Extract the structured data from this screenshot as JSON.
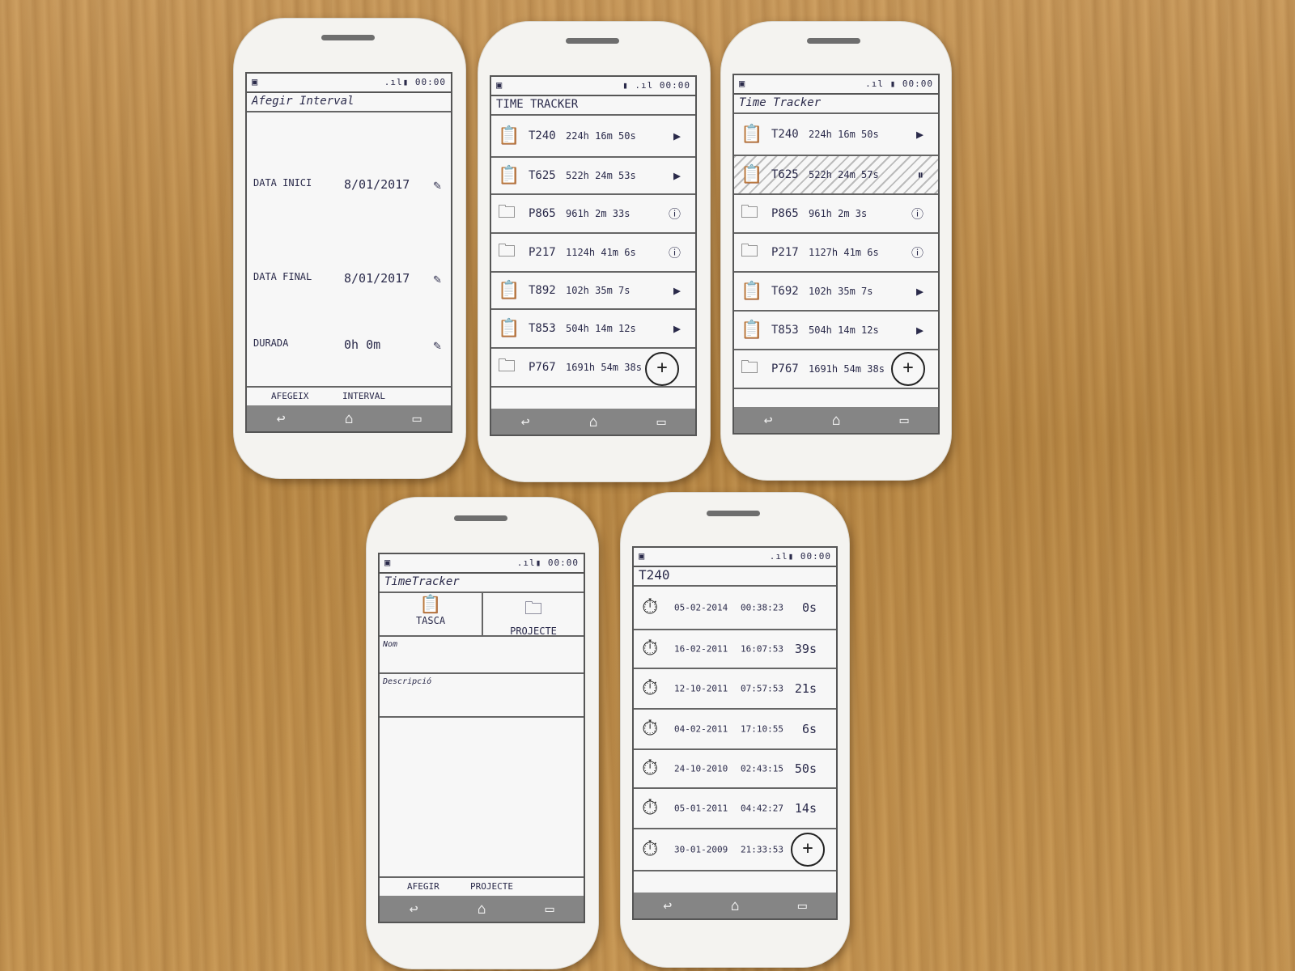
{
  "status": {
    "clock": "00:00",
    "signal": ".ıl"
  },
  "screen1": {
    "title": "Afegir Interval",
    "fields": [
      {
        "label": "DATA INICI",
        "value": "8/01/2017"
      },
      {
        "label": "DATA FINAL",
        "value": "8/01/2017"
      },
      {
        "label": "DURADA",
        "value": "0h 0m"
      }
    ],
    "actions": [
      "AFEGEIX",
      "INTERVAL"
    ]
  },
  "screen2": {
    "title": "TIME TRACKER",
    "items": [
      {
        "kind": "task",
        "name": "T240",
        "time": "224h 16m 50s",
        "status": "play"
      },
      {
        "kind": "task",
        "name": "T625",
        "time": "522h 24m 53s",
        "status": "play"
      },
      {
        "kind": "project",
        "name": "P865",
        "time": "961h 2m 33s",
        "status": "info"
      },
      {
        "kind": "project",
        "name": "P217",
        "time": "1124h 41m 6s",
        "status": "info"
      },
      {
        "kind": "task",
        "name": "T892",
        "time": "102h 35m 7s",
        "status": "play"
      },
      {
        "kind": "task",
        "name": "T853",
        "time": "504h 14m 12s",
        "status": "play"
      },
      {
        "kind": "project",
        "name": "P767",
        "time": "1691h 54m 38s",
        "status": ""
      }
    ]
  },
  "screen3": {
    "title": "Time Tracker",
    "items": [
      {
        "kind": "task",
        "name": "T240",
        "time": "224h 16m 50s",
        "status": "play"
      },
      {
        "kind": "task",
        "name": "T625",
        "time": "522h 24m 57s",
        "status": "pause"
      },
      {
        "kind": "project",
        "name": "P865",
        "time": "961h 2m 3s",
        "status": "info"
      },
      {
        "kind": "project",
        "name": "P217",
        "time": "1127h 41m 6s",
        "status": "info"
      },
      {
        "kind": "task",
        "name": "T692",
        "time": "102h 35m 7s",
        "status": "play"
      },
      {
        "kind": "task",
        "name": "T853",
        "time": "504h 14m 12s",
        "status": "play"
      },
      {
        "kind": "project",
        "name": "P767",
        "time": "1691h 54m 38s",
        "status": ""
      }
    ]
  },
  "screen4": {
    "title": "TimeTracker",
    "tabs": [
      "TASCA",
      "PROJECTE"
    ],
    "fields": [
      "Nom",
      "Descripció"
    ],
    "actions": [
      "AFEGIR",
      "PROJECTE"
    ]
  },
  "screen5": {
    "title": "T240",
    "intervals": [
      {
        "date": "05-02-2014",
        "time": "00:38:23",
        "duration": "0s"
      },
      {
        "date": "16-02-2011",
        "time": "16:07:53",
        "duration": "39s"
      },
      {
        "date": "12-10-2011",
        "time": "07:57:53",
        "duration": "21s"
      },
      {
        "date": "04-02-2011",
        "time": "17:10:55",
        "duration": "6s"
      },
      {
        "date": "24-10-2010",
        "time": "02:43:15",
        "duration": "50s"
      },
      {
        "date": "05-01-2011",
        "time": "04:42:27",
        "duration": "14s"
      },
      {
        "date": "30-01-2009",
        "time": "21:33:53",
        "duration": ""
      }
    ]
  },
  "icons": {
    "back": "↩",
    "home": "⌂",
    "recent": "▭",
    "task": "📋",
    "project": "🗀",
    "play": "▶",
    "pause": "⏸",
    "info": "ⓘ",
    "add": "+",
    "pen": "✎",
    "clock": "⏱",
    "app": "▣",
    "battery": "▮"
  }
}
